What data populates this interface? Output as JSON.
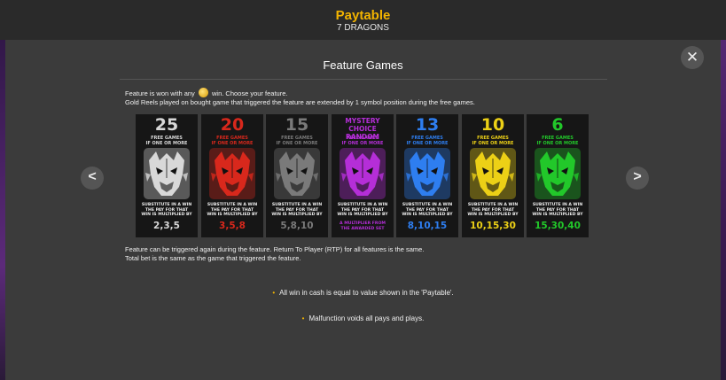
{
  "header": {
    "title": "Paytable",
    "subtitle": "7 DRAGONS"
  },
  "section": {
    "title": "Feature Games"
  },
  "controls": {
    "close_icon": "✕",
    "prev_icon": "<",
    "next_icon": ">"
  },
  "intro": {
    "line1_before": "Feature is won with any",
    "line1_after": "win. Choose your feature.",
    "line2": "Gold Reels played on bought game that triggered the feature are extended by 1 symbol position during the free games."
  },
  "cards": [
    {
      "count": "25",
      "free_label": "FREE GAMES",
      "sub_label": "IF ONE OR MORE",
      "substitute": "SUBSTITUTE IN A WIN THE PAY FOR THAT WIN IS MULTIPLIED BY",
      "multiplier": "2,3,5",
      "color": "#d8d8d8",
      "icon": "dragon-icon-white"
    },
    {
      "count": "20",
      "free_label": "FREE GAMES",
      "sub_label": "IF ONE OR MORE",
      "substitute": "SUBSTITUTE IN A WIN THE PAY FOR THAT WIN IS MULTIPLIED BY",
      "multiplier": "3,5,8",
      "color": "#d8281c",
      "icon": "dragon-icon-red"
    },
    {
      "count": "15",
      "free_label": "FREE GAMES",
      "sub_label": "IF ONE OR MORE",
      "substitute": "SUBSTITUTE IN A WIN THE PAY FOR THAT WIN IS MULTIPLIED BY",
      "multiplier": "5,8,10",
      "color": "#7a7a7a",
      "icon": "dragon-icon-gray"
    },
    {
      "count": "MYSTERY CHOICE RANDOM",
      "free_label": "FREE GAMES",
      "sub_label": "IF ONE OR MORE",
      "substitute": "SUBSTITUTE IN A WIN THE PAY FOR THAT WIN IS MULTIPLIED BY",
      "multiplier": "A MULTIPLIER FROM THE AWARDED SET",
      "color": "#b52ed8",
      "icon": "dragon-icon-purple"
    },
    {
      "count": "13",
      "free_label": "FREE GAMES",
      "sub_label": "IF ONE OR MORE",
      "substitute": "SUBSTITUTE IN A WIN THE PAY FOR THAT WIN IS MULTIPLIED BY",
      "multiplier": "8,10,15",
      "color": "#2e7ef0",
      "icon": "dragon-icon-blue"
    },
    {
      "count": "10",
      "free_label": "FREE GAMES",
      "sub_label": "IF ONE OR MORE",
      "substitute": "SUBSTITUTE IN A WIN THE PAY FOR THAT WIN IS MULTIPLIED BY",
      "multiplier": "10,15,30",
      "color": "#ecd016",
      "icon": "dragon-icon-yellow"
    },
    {
      "count": "6",
      "free_label": "FREE GAMES",
      "sub_label": "IF ONE OR MORE",
      "substitute": "SUBSTITUTE IN A WIN THE PAY FOR THAT WIN IS MULTIPLIED BY",
      "multiplier": "15,30,40",
      "color": "#22c82a",
      "icon": "dragon-icon-green"
    }
  ],
  "after": {
    "line1": "Feature can be triggered again during the feature. Return To Player (RTP) for all features is the same.",
    "line2": "Total bet is the same as the game that triggered the feature."
  },
  "bullets": [
    "All win in cash is equal to value shown in the 'Paytable'.",
    "Malfunction voids all pays and plays."
  ],
  "colors": {
    "accent": "#f2b300",
    "background": "#3b3b3b",
    "header": "#2a2a2a"
  }
}
